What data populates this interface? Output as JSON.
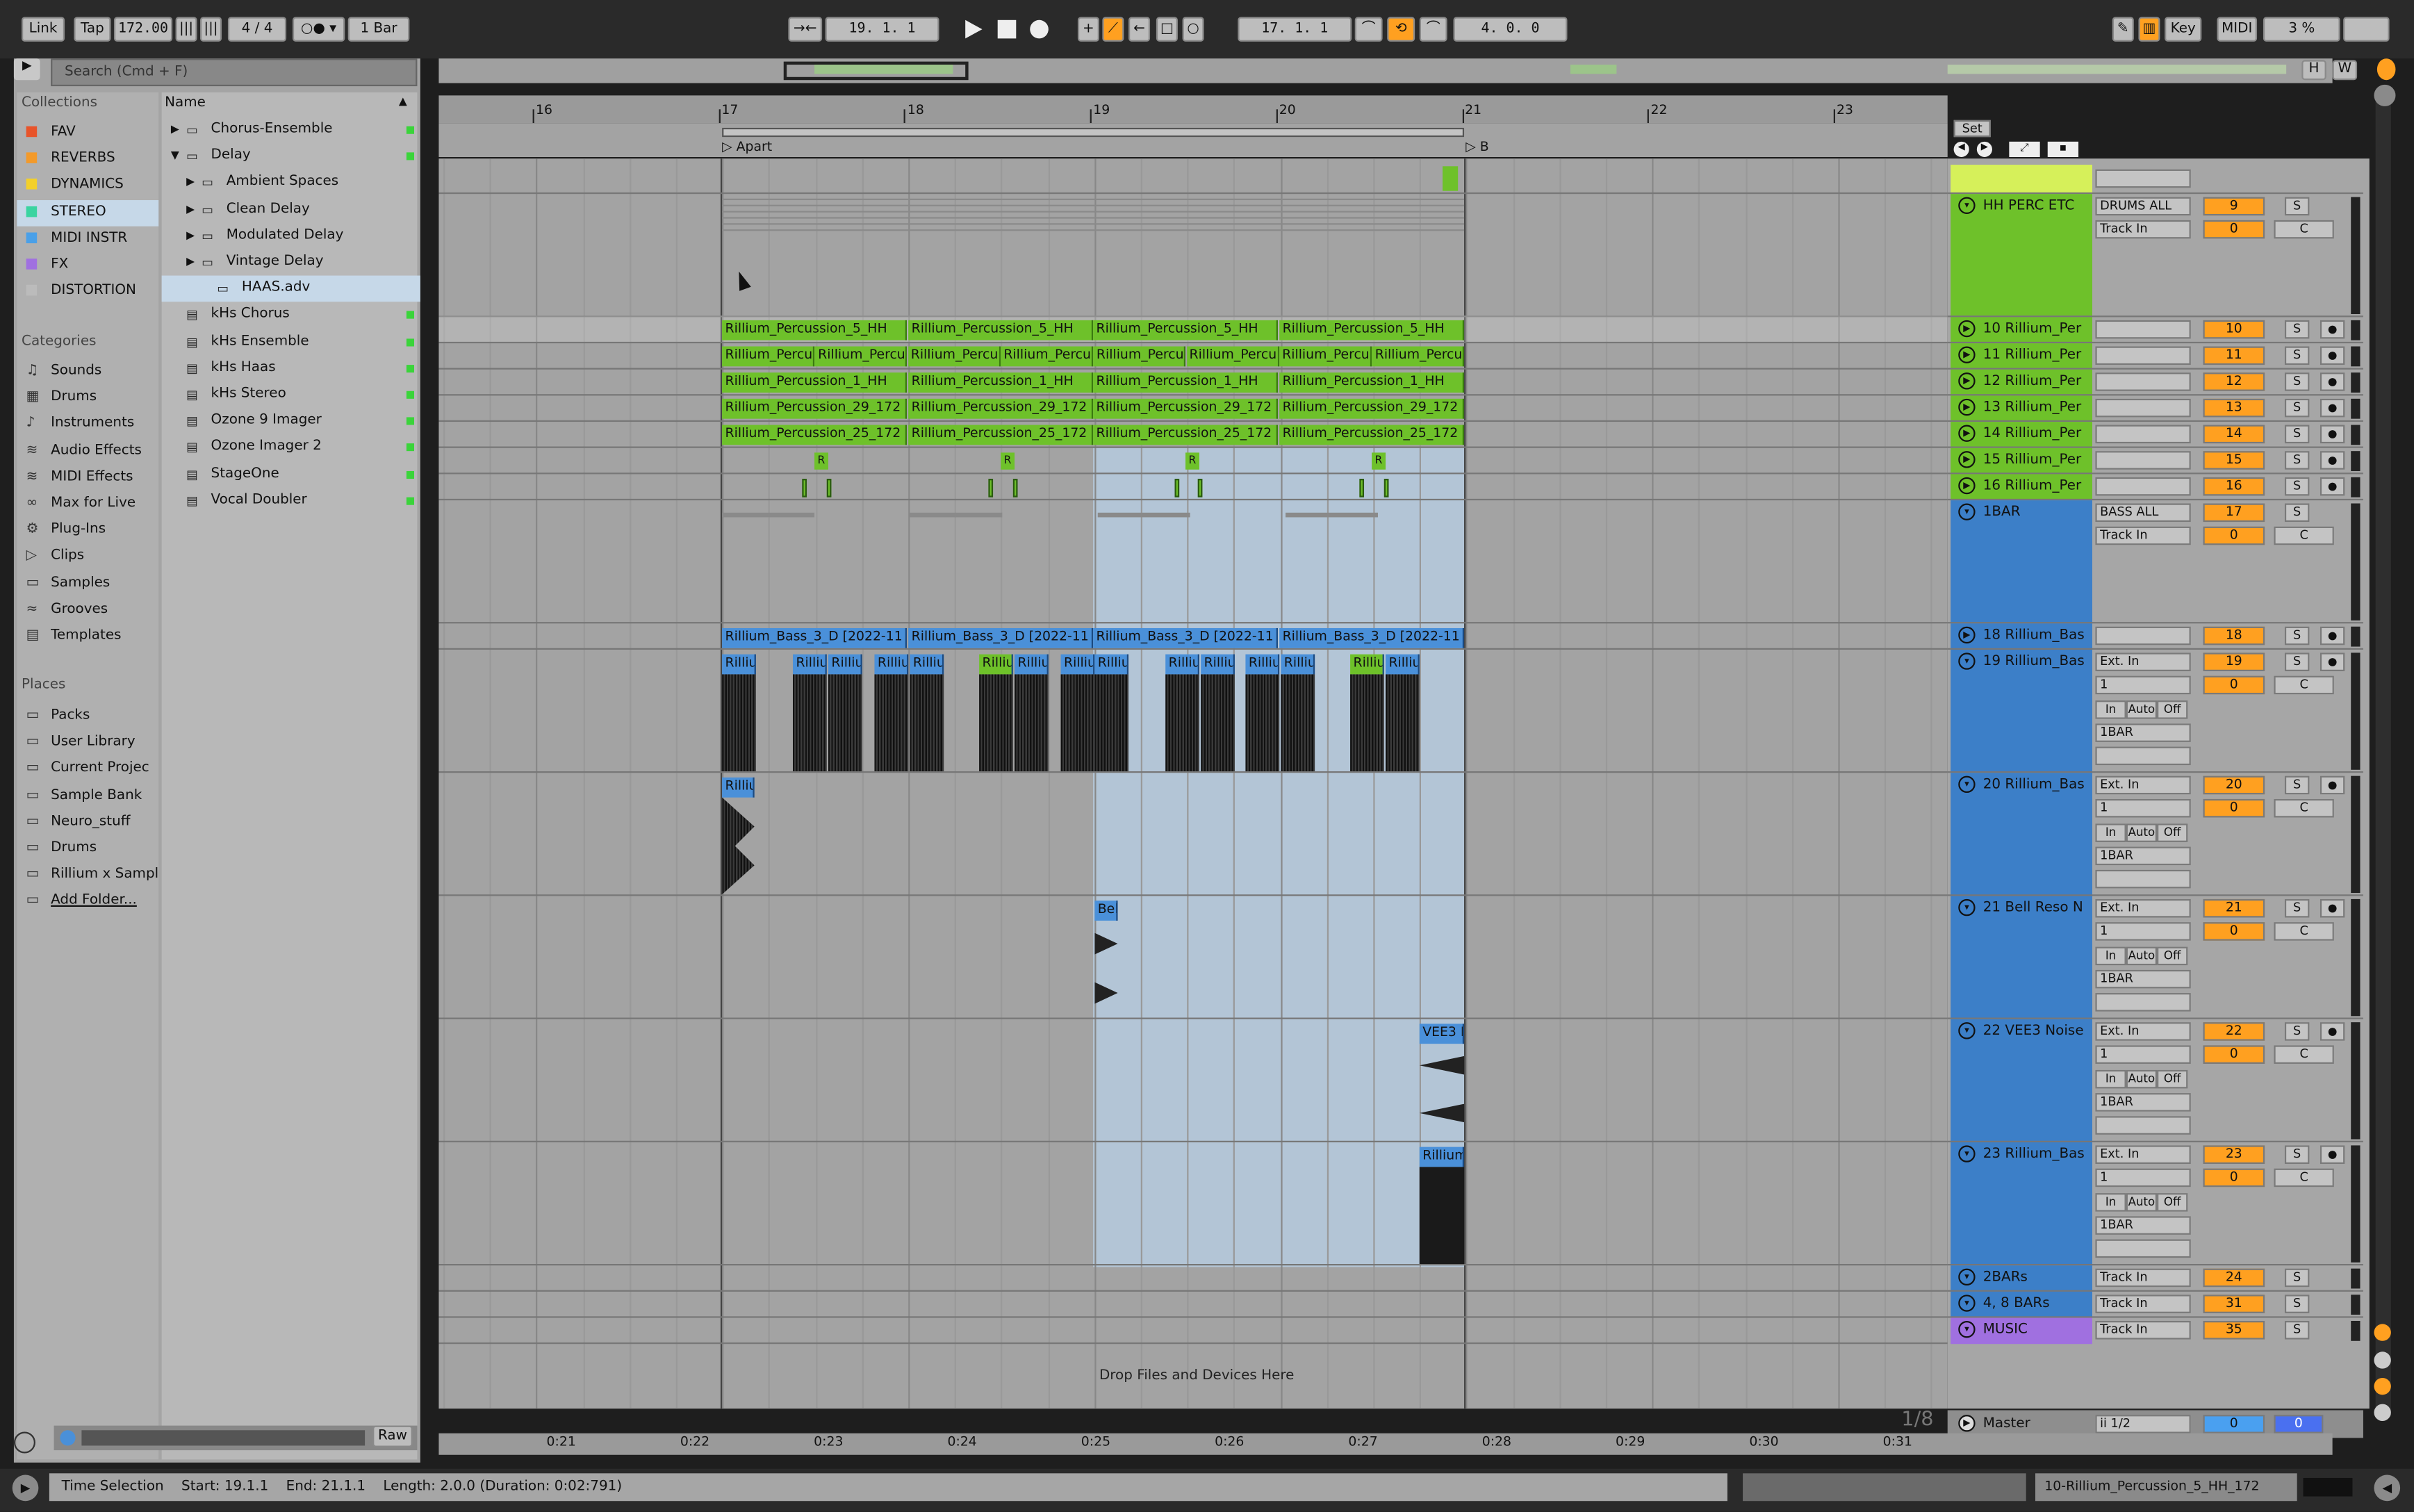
{
  "toolbar": {
    "link": "Link",
    "tap": "Tap",
    "tempo": "172.00",
    "time_sig": "4 / 4",
    "quant": "1 Bar",
    "position": "19.  1.  1",
    "loop_start": "17.  1.  1",
    "loop_length": "4.  0.  0",
    "key": "Key",
    "midi": "MIDI",
    "cpu": "3 %",
    "accent": "#ffa020"
  },
  "browser": {
    "search_placeholder": "Search (Cmd + F)",
    "collections_title": "Collections",
    "collections": [
      {
        "label": "FAV",
        "color": "#e8542a"
      },
      {
        "label": "REVERBS",
        "color": "#f39a2a"
      },
      {
        "label": "DYNAMICS",
        "color": "#f3d02a"
      },
      {
        "label": "STEREO",
        "color": "#3ad4a0"
      },
      {
        "label": "MIDI INSTR",
        "color": "#4aa0e8"
      },
      {
        "label": "FX",
        "color": "#a070e0"
      },
      {
        "label": "DISTORTION",
        "color": "#bbbbbb"
      }
    ],
    "categories_title": "Categories",
    "categories": [
      "Sounds",
      "Drums",
      "Instruments",
      "Audio Effects",
      "MIDI Effects",
      "Max for Live",
      "Plug-Ins",
      "Clips",
      "Samples",
      "Grooves",
      "Templates"
    ],
    "places_title": "Places",
    "places": [
      "Packs",
      "User Library",
      "Current Projec",
      "Sample Bank",
      "Neuro_stuff",
      "Drums",
      "Rillium x Sampl",
      "Add Folder..."
    ],
    "name_header": "Name",
    "items": [
      "Chorus-Ensemble",
      "Delay",
      "Ambient Spaces",
      "Clean Delay",
      "Modulated Delay",
      "Vintage Delay",
      "HAAS.adv",
      "kHs Chorus",
      "kHs Ensemble",
      "kHs Haas",
      "kHs Stereo",
      "Ozone 9 Imager",
      "Ozone Imager 2",
      "StageOne",
      "Vocal Doubler"
    ],
    "raw": "Raw"
  },
  "arrangement": {
    "bars": [
      "16",
      "17",
      "18",
      "19",
      "20",
      "21",
      "22",
      "23"
    ],
    "locators": [
      "Apart",
      "B"
    ],
    "set": "Set",
    "times": [
      "0:21",
      "0:22",
      "0:23",
      "0:24",
      "0:25",
      "0:26",
      "0:27",
      "0:28",
      "0:29",
      "0:30",
      "0:31"
    ],
    "drop_text": "Drop Files and Devices Here",
    "zoom": "1/8"
  },
  "clips": {
    "perc5": "Rillium_Percussion_5_HH",
    "percu": "Rillium_Percu",
    "perc1": "Rillium_Percussion_1_HH",
    "perc29": "Rillium_Percussion_29_172",
    "perc25": "Rillium_Percussion_25_172",
    "bass": "Rillium_Bass_3_D [2022-11",
    "rill": "Rilliu",
    "bell": "Bel",
    "vee": "VEE3 I",
    "rillium": "Rillium",
    "r": "R"
  },
  "tracks": [
    {
      "name": "HH PERC ETC",
      "io": "DRUMS ALL",
      "io2": "Track In",
      "num": "9",
      "vol": "0",
      "s": "S",
      "c": "C"
    },
    {
      "name": "10 Rillium_Per",
      "num": "10"
    },
    {
      "name": "11 Rillium_Per",
      "num": "11"
    },
    {
      "name": "12 Rillium_Per",
      "num": "12"
    },
    {
      "name": "13 Rillium_Per",
      "num": "13"
    },
    {
      "name": "14 Rillium_Per",
      "num": "14"
    },
    {
      "name": "15 Rillium_Per",
      "num": "15"
    },
    {
      "name": "16 Rillium_Per",
      "num": "16"
    },
    {
      "name": "1BAR",
      "io": "BASS ALL",
      "io2": "Track In",
      "num": "17",
      "vol": "0"
    },
    {
      "name": "18 Rillium_Bas",
      "num": "18"
    },
    {
      "name": "19 Rillium_Bas",
      "num": "19",
      "io": "Ext. In",
      "ch": "1",
      "vol": "0",
      "mon": [
        "In",
        "Auto",
        "Off"
      ],
      "out": "1BAR"
    },
    {
      "name": "20 Rillium_Bas",
      "num": "20",
      "io": "Ext. In",
      "ch": "1",
      "vol": "0",
      "mon": [
        "In",
        "Auto",
        "Off"
      ],
      "out": "1BAR"
    },
    {
      "name": "21 Bell Reso N",
      "num": "21",
      "io": "Ext. In",
      "ch": "1",
      "vol": "0",
      "mon": [
        "In",
        "Auto",
        "Off"
      ],
      "out": "1BAR"
    },
    {
      "name": "22 VEE3 Noise",
      "num": "22",
      "io": "Ext. In",
      "ch": "1",
      "vol": "0",
      "mon": [
        "In",
        "Auto",
        "Off"
      ],
      "out": "1BAR"
    },
    {
      "name": "23 Rillium_Bas",
      "num": "23",
      "io": "Ext. In",
      "ch": "1",
      "vol": "0",
      "mon": [
        "In",
        "Auto",
        "Off"
      ],
      "out": "1BAR"
    },
    {
      "name": "2BARs",
      "io": "Track In",
      "num": "24"
    },
    {
      "name": "4, 8 BARs",
      "io": "Track In",
      "num": "31"
    },
    {
      "name": "MUSIC",
      "io": "Track In",
      "num": "35"
    },
    {
      "name": "Master",
      "io": "ii 1/2",
      "vol": "0",
      "pan": "0"
    }
  ],
  "status": {
    "selection": "Time Selection",
    "start": "Start: 19.1.1",
    "end": "End: 21.1.1",
    "length": "Length: 2.0.0 (Duration: 0:02:791)",
    "clip": "10-Rillium_Percussion_5_HH_172"
  }
}
